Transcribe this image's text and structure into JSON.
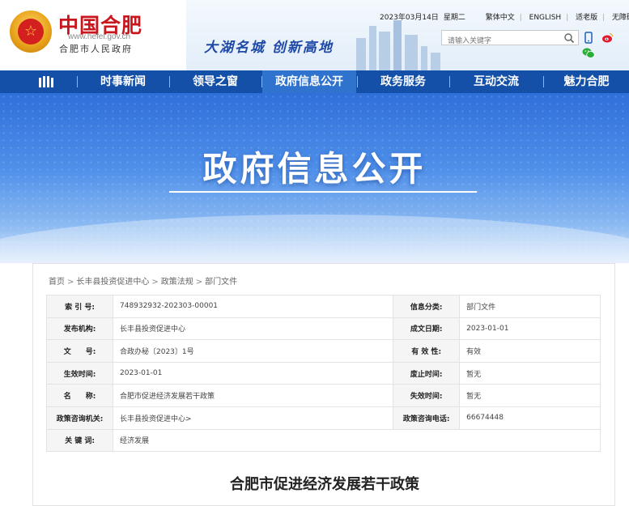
{
  "header": {
    "logo_title": "中国合肥",
    "logo_url": "www.hefei.gov.cn",
    "logo_gov": "合肥市人民政府",
    "slogan": "大湖名城   创新高地",
    "emblem_glyph": "☆",
    "date": "2023年03月14日",
    "weekday": "星期二",
    "links": [
      "繁体中文",
      "ENGLISH",
      "适老版",
      "无障碍"
    ],
    "search_placeholder": "请输入关键字",
    "icons": [
      "search-icon",
      "mobile-icon",
      "weibo-icon",
      "wechat-icon"
    ]
  },
  "nav": {
    "items": [
      "时事新闻",
      "领导之窗",
      "政府信息公开",
      "政务服务",
      "互动交流",
      "魅力合肥"
    ],
    "active_index": 2
  },
  "banner": {
    "title": "政府信息公开"
  },
  "breadcrumb": [
    "首页",
    "长丰县投资促进中心",
    "政策法规",
    "部门文件"
  ],
  "meta": {
    "rows": [
      {
        "k1": "索 引 号:",
        "v1": "748932932-202303-00001",
        "k2": "信息分类:",
        "v2": "部门文件"
      },
      {
        "k1": "发布机构:",
        "v1": "长丰县投资促进中心",
        "k2": "成文日期:",
        "v2": "2023-01-01"
      },
      {
        "k1": "文　　号:",
        "v1": "合政办秘〔2023〕1号",
        "k2": "有 效 性:",
        "v2": "有效"
      },
      {
        "k1": "生效时间:",
        "v1": "2023-01-01",
        "k2": "废止时间:",
        "v2": "暂无"
      },
      {
        "k1": "名　　称:",
        "v1": "合肥市促进经济发展若干政策",
        "k2": "失效时间:",
        "v2": "暂无"
      },
      {
        "k1": "政策咨询机关:",
        "v1": "长丰县投资促进中心>",
        "k2": "政策咨询电话:",
        "v2": "66674448"
      },
      {
        "k1": "关 键 词:",
        "v1": "经济发展"
      }
    ]
  },
  "doc_title": "合肥市促进经济发展若干政策",
  "colors": {
    "nav_bg": "#1550a8",
    "nav_active": "#2f73cf",
    "logo_red": "#c8161d",
    "slogan_blue": "#1f4aa8"
  }
}
